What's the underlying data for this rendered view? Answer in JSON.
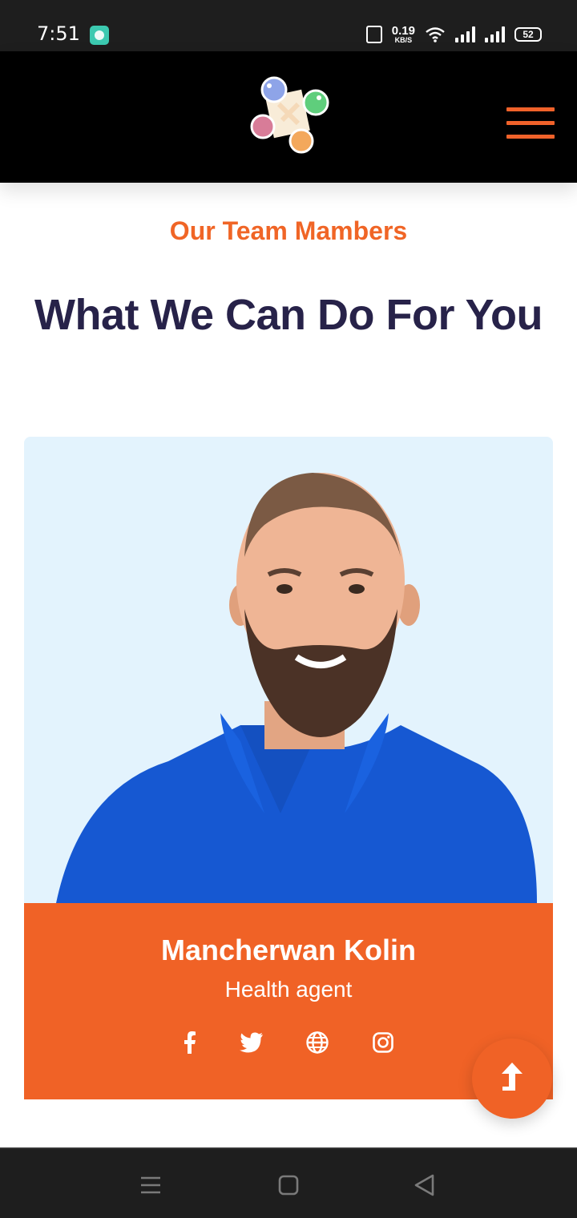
{
  "status_bar": {
    "time": "7:51",
    "net_speed_value": "0.19",
    "net_speed_unit": "KB/S",
    "battery": "52"
  },
  "header": {
    "logo": "colorful-chat-bubbles-logo",
    "menu_icon": "hamburger-menu-icon",
    "accent_color": "#f0622a"
  },
  "section": {
    "eyebrow": "Our Team Mambers",
    "headline": "What We Can Do For You"
  },
  "team_member": {
    "name": "Mancherwan Kolin",
    "role": "Health agent",
    "photo": "bearded-man-in-blue-polo-shirt",
    "card_color": "#f06226",
    "socials": [
      "facebook-icon",
      "twitter-icon",
      "globe-icon",
      "instagram-icon"
    ]
  },
  "scroll_top": {
    "icon": "arrow-up-icon"
  },
  "system_nav": [
    "recents-icon",
    "home-icon",
    "back-icon"
  ]
}
